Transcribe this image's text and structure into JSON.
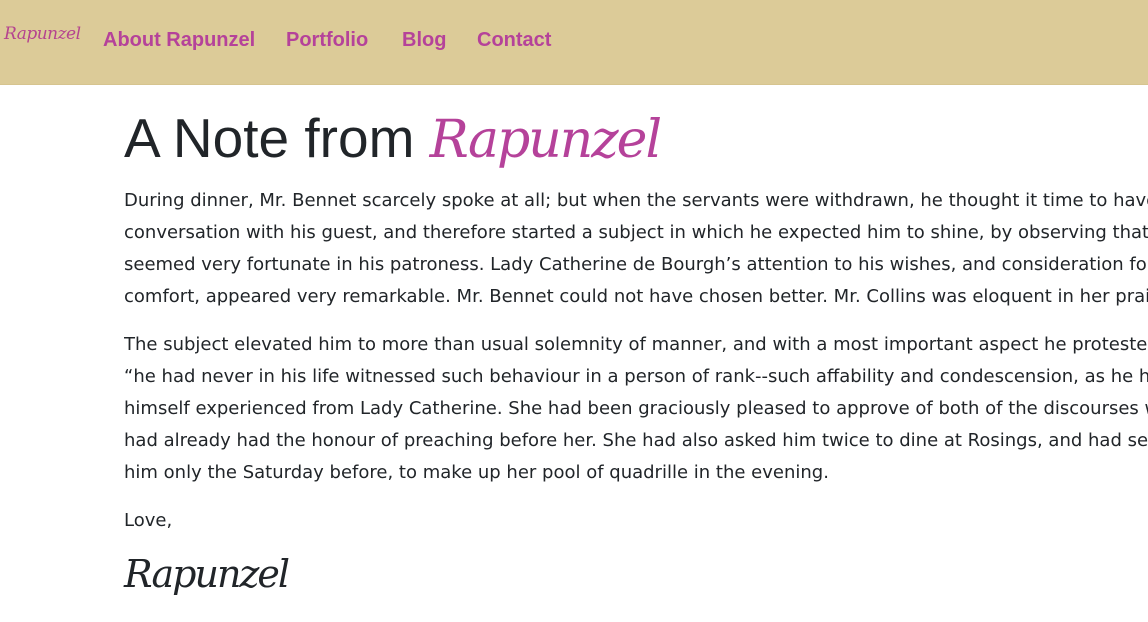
{
  "nav": {
    "brand": "Rapunzel",
    "links": [
      "About Rapunzel",
      "Portfolio",
      "Blog",
      "Contact"
    ]
  },
  "main": {
    "title_prefix": "A Note from",
    "title_script": "Rapunzel",
    "paragraphs": [
      [
        "During dinner, Mr. Bennet scarcely spoke at all; but when the servants were withdrawn, he thought it time to have so",
        "conversation with his guest, and therefore started a subject in which he expected him to shine, by observing that he",
        "seemed very fortunate in his patroness. Lady Catherine de Bourgh’s attention to his wishes, and consideration for his",
        "comfort, appeared very remarkable. Mr. Bennet could not have chosen better. Mr. Collins was eloquent in her praise."
      ],
      [
        "The subject elevated him to more than usual solemnity of manner, and with a most important aspect he protested th",
        "“he had never in his life witnessed such behaviour in a person of rank--such affability and condescension, as he had",
        "himself experienced from Lady Catherine. She had been graciously pleased to approve of both of the discourses whic",
        "had already had the honour of preaching before her. She had also asked him twice to dine at Rosings, and had sent f",
        "him only the Saturday before, to make up her pool of quadrille in the evening."
      ]
    ],
    "closing": "Love,",
    "signature": "Rapunzel"
  }
}
